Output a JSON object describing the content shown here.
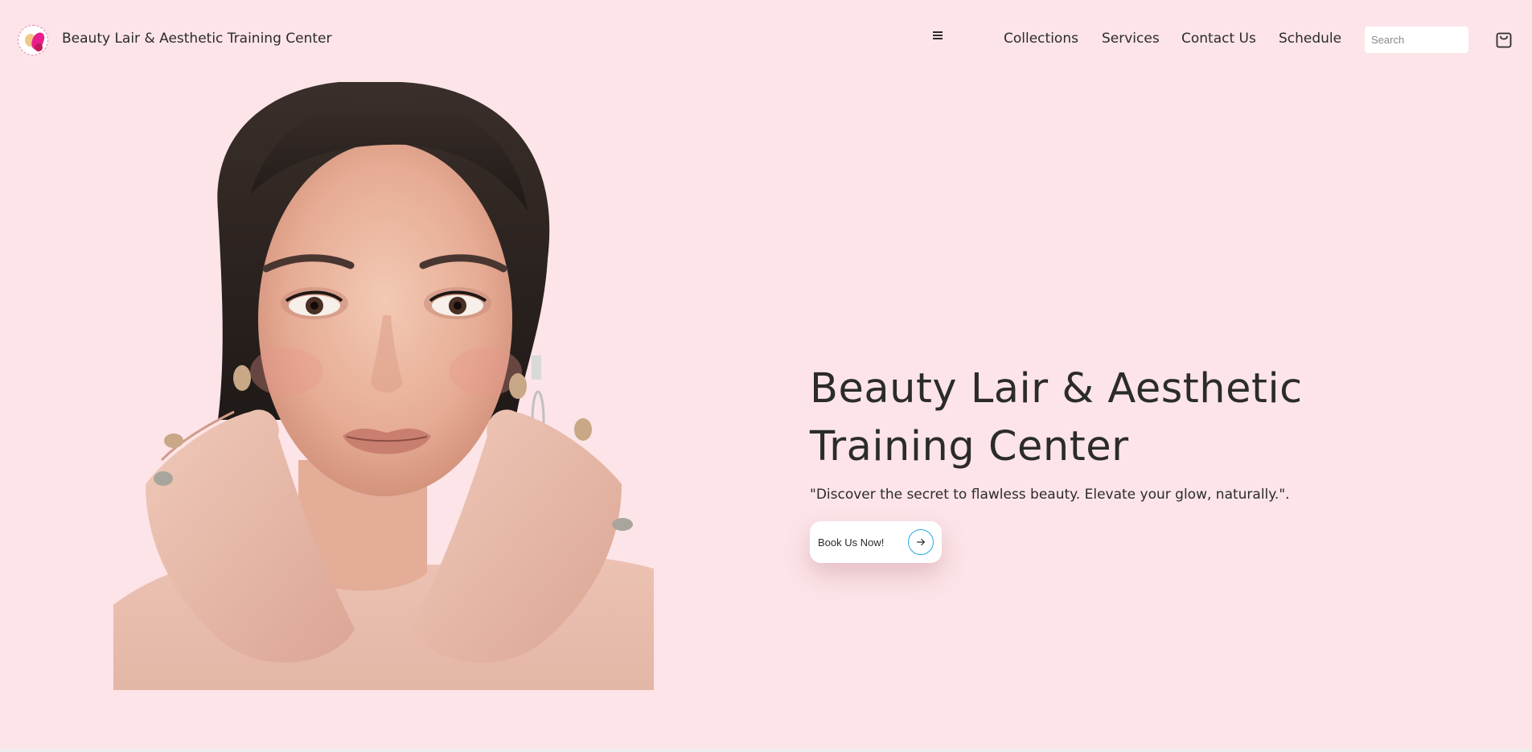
{
  "header": {
    "brand_name": "Beauty Lair & Aesthetic Training Center",
    "logo_icon": "salon-logo-icon",
    "menu_icon": "hamburger-menu-icon",
    "nav": {
      "collections": "Collections",
      "services": "Services",
      "contact": "Contact Us",
      "schedule": "Schedule"
    },
    "search": {
      "placeholder": "Search",
      "value": ""
    },
    "cart_icon": "shopping-bag-icon"
  },
  "hero": {
    "image_alt": "Woman with hands framing her face",
    "title": "Beauty Lair & Aesthetic Training Center",
    "subtitle": "\"Discover the secret to flawless beauty. Elevate your glow, naturally.\".",
    "cta": {
      "label": "Book Us Now!",
      "icon": "arrow-right-icon"
    }
  },
  "colors": {
    "background": "#fce4e8",
    "text": "#2b2b2b",
    "accent": "#29a9e0",
    "brand_pink": "#e91e8c"
  }
}
